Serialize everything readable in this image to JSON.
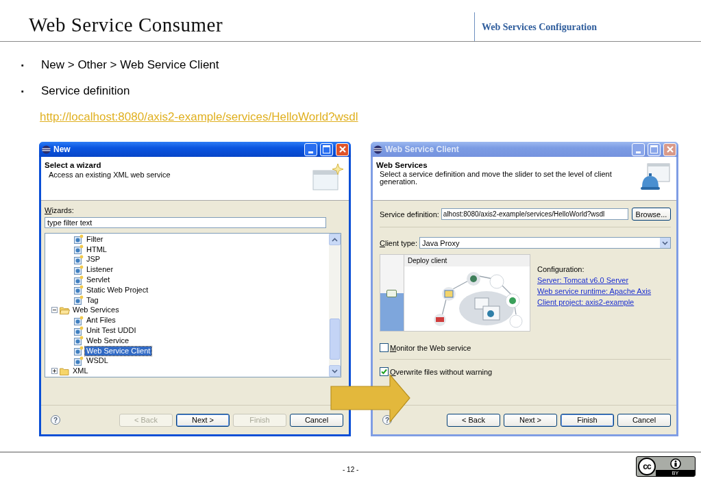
{
  "slide": {
    "title": "Web Service Consumer",
    "section": "Web Services Configuration",
    "bullets": [
      {
        "marker": "▪",
        "text": "New > Other > Web Service Client"
      },
      {
        "marker": "▪",
        "text": "Service definition"
      }
    ],
    "link": "http://localhost:8080/axis2-example/services/HelloWorld?wsdl",
    "page_number": "- 12 -",
    "license_badge": {
      "symbol": "cc",
      "label": "BY"
    }
  },
  "windows": [
    {
      "kind": "wizard_selection",
      "title": "New",
      "active": true,
      "header": {
        "title": "Select a wizard",
        "description": "Access an existing XML web service"
      },
      "wizards_label": "Wizards:",
      "filter": {
        "value": "type filter text"
      },
      "tree": {
        "continued_children": [
          {
            "label": "Filter",
            "kind": "file",
            "selected": false
          },
          {
            "label": "HTML",
            "kind": "file",
            "selected": false
          },
          {
            "label": "JSP",
            "kind": "file",
            "selected": false
          },
          {
            "label": "Listener",
            "kind": "file",
            "selected": false
          },
          {
            "label": "Servlet",
            "kind": "file",
            "selected": false
          },
          {
            "label": "Static Web Project",
            "kind": "file",
            "selected": false
          },
          {
            "label": "Tag",
            "kind": "file",
            "selected": false
          }
        ],
        "items": [
          {
            "label": "Web Services",
            "kind": "folder",
            "expanded": true,
            "selected": false,
            "children": [
              {
                "label": "Ant Files",
                "kind": "file",
                "selected": false
              },
              {
                "label": "Unit Test UDDI",
                "kind": "file",
                "selected": false
              },
              {
                "label": "Web Service",
                "kind": "file",
                "selected": false
              },
              {
                "label": "Web Service Client",
                "kind": "file",
                "selected": true
              },
              {
                "label": "WSDL",
                "kind": "file",
                "selected": false
              }
            ]
          },
          {
            "label": "XML",
            "kind": "folder",
            "expanded": false,
            "selected": false
          }
        ]
      },
      "help": "?",
      "buttons": [
        {
          "label": "< Back",
          "disabled": true,
          "default": false
        },
        {
          "label": "Next >",
          "disabled": false,
          "default": true
        },
        {
          "label": "Finish",
          "disabled": true,
          "default": false
        },
        {
          "label": "Cancel",
          "disabled": false,
          "default": false
        }
      ]
    },
    {
      "kind": "web_service_client",
      "title": "Web Service Client",
      "active": false,
      "header": {
        "title": "Web Services",
        "description": "Select a service definition and move the slider to set the level of client generation."
      },
      "service_definition": {
        "label": "Service definition:",
        "value": "alhost:8080/axis2-example/services/HelloWorld?wsdl",
        "browse": "Browse..."
      },
      "client_type": {
        "label": "Client type:",
        "value": "Java Proxy"
      },
      "slider": {
        "level": 0.5,
        "caption": "Deploy client"
      },
      "configuration": {
        "heading": "Configuration:",
        "links": [
          "Server: Tomcat v6.0 Server",
          "Web service runtime: Apache Axis",
          "Client project: axis2-example"
        ]
      },
      "checkboxes": [
        {
          "label": "Monitor the Web service",
          "checked": false
        },
        {
          "label": "Overwrite files without warning",
          "checked": true
        }
      ],
      "help": "?",
      "buttons": [
        {
          "label": "< Back",
          "disabled": false,
          "default": false
        },
        {
          "label": "Next >",
          "disabled": false,
          "default": false
        },
        {
          "label": "Finish",
          "disabled": false,
          "default": true
        },
        {
          "label": "Cancel",
          "disabled": false,
          "default": false
        }
      ]
    }
  ]
}
